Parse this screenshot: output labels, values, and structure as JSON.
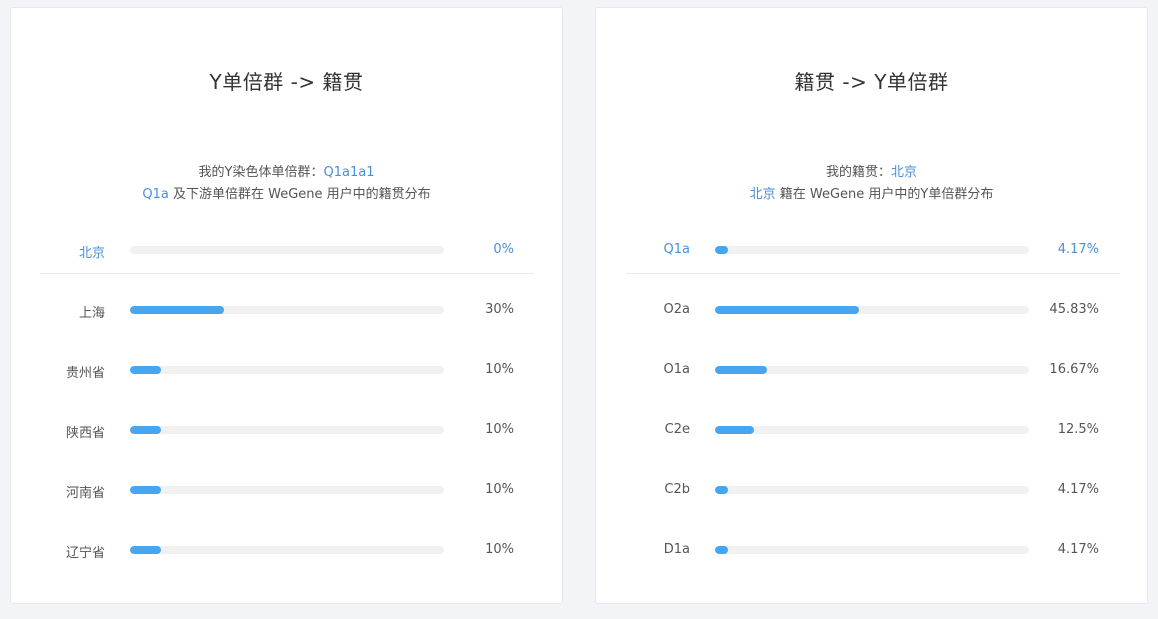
{
  "panels": [
    {
      "title": "Y单倍群 -> 籍贯",
      "sub1_prefix": "我的Y染色体单倍群：",
      "sub1_value": "Q1a1a1",
      "sub2_highlight": "Q1a",
      "sub2_text": " 及下游单倍群在 WeGene 用户中的籍贯分布"
    },
    {
      "title": "籍贯 -> Y单倍群",
      "sub1_prefix": "我的籍贯：",
      "sub1_value": "北京",
      "sub2_highlight": "北京",
      "sub2_text": " 籍在 WeGene 用户中的Y单倍群分布"
    }
  ],
  "colors": {
    "bar": "#46a6f1",
    "track": "#f1f1f1",
    "highlight": "#4a90d9"
  },
  "chart_data": [
    {
      "type": "bar",
      "orientation": "horizontal",
      "title": "Y单倍群 -> 籍贯",
      "categories": [
        "北京",
        "上海",
        "贵州省",
        "陕西省",
        "河南省",
        "辽宁省"
      ],
      "values": [
        0,
        30,
        10,
        10,
        10,
        10
      ],
      "labels": [
        "0%",
        "30%",
        "10%",
        "10%",
        "10%",
        "10%"
      ],
      "xlim": [
        0,
        100
      ],
      "highlight_index": 0
    },
    {
      "type": "bar",
      "orientation": "horizontal",
      "title": "籍贯 -> Y单倍群",
      "categories": [
        "Q1a",
        "O2a",
        "O1a",
        "C2e",
        "C2b",
        "D1a"
      ],
      "values": [
        4.17,
        45.83,
        16.67,
        12.5,
        4.17,
        4.17
      ],
      "labels": [
        "4.17%",
        "45.83%",
        "16.67%",
        "12.5%",
        "4.17%",
        "4.17%"
      ],
      "xlim": [
        0,
        100
      ],
      "highlight_index": 0
    }
  ]
}
